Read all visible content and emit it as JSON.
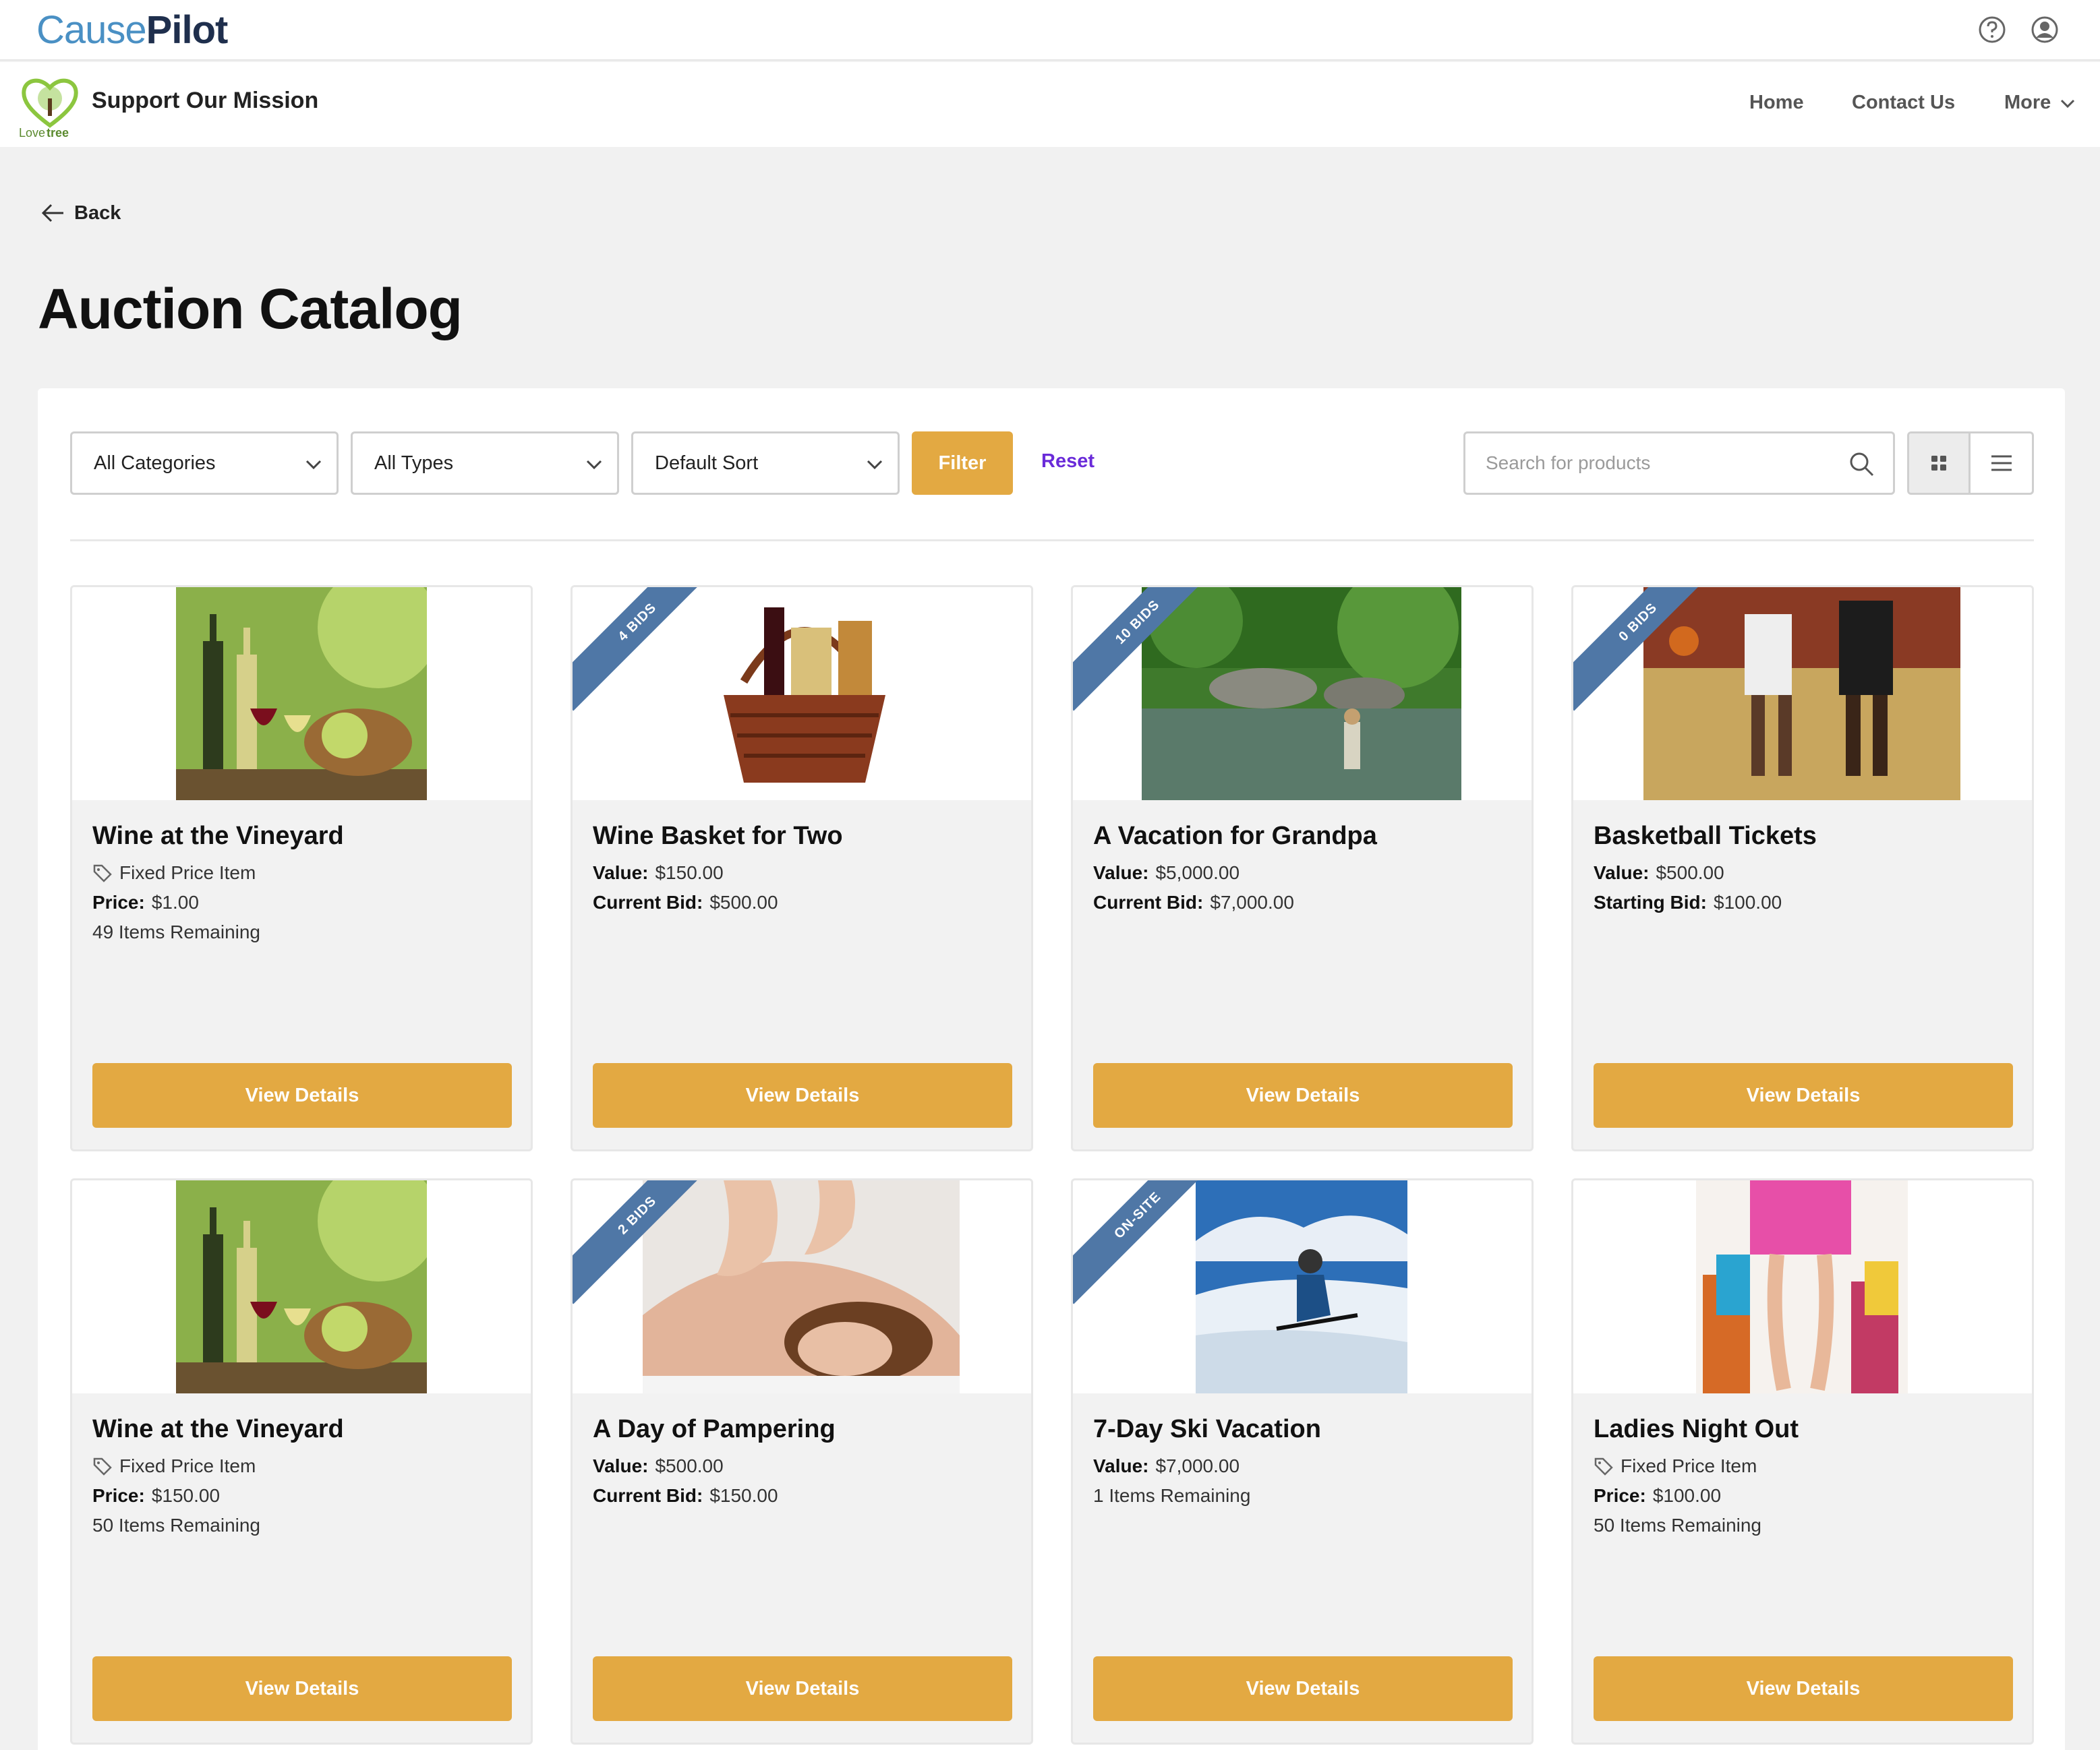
{
  "topbar": {
    "brand_part1": "Cause",
    "brand_part2": "Pilot"
  },
  "site": {
    "logo_text_1": "Love",
    "logo_text_2": "tree",
    "title": "Support Our Mission",
    "nav": [
      "Home",
      "Contact Us",
      "More"
    ]
  },
  "back_label": "Back",
  "page_title": "Auction Catalog",
  "filters": {
    "category": "All Categories",
    "type": "All Types",
    "sort": "Default Sort",
    "filter_label": "Filter",
    "reset_label": "Reset",
    "search_placeholder": "Search for products"
  },
  "cards": [
    {
      "title": "Wine at the Vineyard",
      "ribbon": "",
      "kind": "Fixed Price Item",
      "l1_label": "Price:",
      "l1_value": "$1.00",
      "l2_label": "",
      "l2_value": "",
      "extra": "49 Items Remaining",
      "button": "View Details"
    },
    {
      "title": "Wine Basket for Two",
      "ribbon": "4 BIDS",
      "kind": "",
      "l1_label": "Value:",
      "l1_value": "$150.00",
      "l2_label": "Current Bid:",
      "l2_value": "$500.00",
      "extra": "",
      "button": "View Details"
    },
    {
      "title": "A Vacation for Grandpa",
      "ribbon": "10 BIDS",
      "kind": "",
      "l1_label": "Value:",
      "l1_value": "$5,000.00",
      "l2_label": "Current Bid:",
      "l2_value": "$7,000.00",
      "extra": "",
      "button": "View Details"
    },
    {
      "title": "Basketball Tickets",
      "ribbon": "0 BIDS",
      "kind": "",
      "l1_label": "Value:",
      "l1_value": "$500.00",
      "l2_label": "Starting Bid:",
      "l2_value": "$100.00",
      "extra": "",
      "button": "View Details"
    },
    {
      "title": "Wine at the Vineyard",
      "ribbon": "",
      "kind": "Fixed Price Item",
      "l1_label": "Price:",
      "l1_value": "$150.00",
      "l2_label": "",
      "l2_value": "",
      "extra": "50 Items Remaining",
      "button": "View Details"
    },
    {
      "title": "A Day of Pampering",
      "ribbon": "2 BIDS",
      "kind": "",
      "l1_label": "Value:",
      "l1_value": "$500.00",
      "l2_label": "Current Bid:",
      "l2_value": "$150.00",
      "extra": "",
      "button": "View Details"
    },
    {
      "title": "7-Day Ski Vacation",
      "ribbon": "ON-SITE",
      "kind": "",
      "l1_label": "Value:",
      "l1_value": "$7,000.00",
      "l2_label": "",
      "l2_value": "",
      "extra": "1 Items Remaining",
      "button": "View Details"
    },
    {
      "title": "Ladies Night Out",
      "ribbon": "",
      "kind": "Fixed Price Item",
      "l1_label": "Price:",
      "l1_value": "$100.00",
      "l2_label": "",
      "l2_value": "",
      "extra": "50 Items Remaining",
      "button": "View Details"
    }
  ],
  "colors": {
    "accent": "#e3a942",
    "ribbon": "#4f77a6",
    "reset": "#6a2bd9",
    "brand_blue": "#4a90c4",
    "brand_navy": "#1f2f4d"
  }
}
